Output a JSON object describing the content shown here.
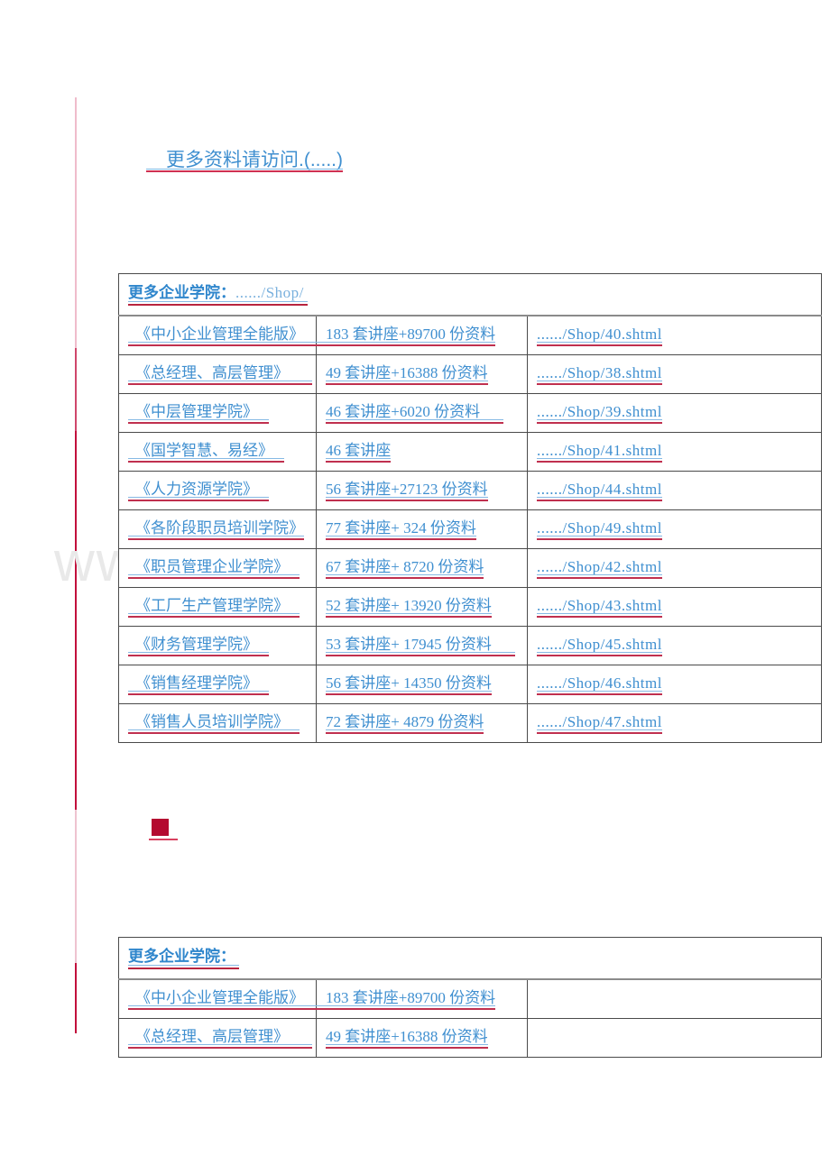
{
  "document": {
    "heading": "更多资料请访问.(.....)",
    "watermark": "www.zixin.com.cn",
    "bullet_marker": "■"
  },
  "colors": {
    "link_blue": "#3f8fd0",
    "heading_blue": "#2f86cc",
    "underline_red": "#c0304f",
    "change_bar_red": "#c2103c",
    "bullet_red": "#b40a30",
    "table_border": "#4a4a4a",
    "watermark_gray": "#e9e9e9"
  },
  "main_table": {
    "header": {
      "title": "更多企业学院：",
      "path": "....../Shop/"
    },
    "rows": [
      {
        "name": "《中小企业管理全能版》",
        "detail": "183 套讲座+89700 份资料",
        "url": "....../Shop/40.shtml"
      },
      {
        "name": "《总经理、高层管理》",
        "detail": "49 套讲座+16388 份资料",
        "url": "....../Shop/38.shtml"
      },
      {
        "name": "《中层管理学院》",
        "detail": "46 套讲座+6020 份资料",
        "url": "....../Shop/39.shtml"
      },
      {
        "name": "《国学智慧、易经》",
        "detail": "46 套讲座",
        "url": "....../Shop/41.shtml"
      },
      {
        "name": "《人力资源学院》",
        "detail": "56 套讲座+27123 份资料",
        "url": "....../Shop/44.shtml"
      },
      {
        "name": "《各阶段职员培训学院》",
        "detail": "77 套讲座+ 324 份资料",
        "url": "....../Shop/49.shtml"
      },
      {
        "name": "《职员管理企业学院》",
        "detail": "67 套讲座+ 8720 份资料",
        "url": "....../Shop/42.shtml"
      },
      {
        "name": "《工厂生产管理学院》",
        "detail": "52 套讲座+ 13920 份资料",
        "url": "....../Shop/43.shtml"
      },
      {
        "name": "《财务管理学院》",
        "detail": "53 套讲座+ 17945 份资料",
        "url": "....../Shop/45.shtml"
      },
      {
        "name": "《销售经理学院》",
        "detail": "56 套讲座+ 14350 份资料",
        "url": "....../Shop/46.shtml"
      },
      {
        "name": "《销售人员培训学院》",
        "detail": "72 套讲座+ 4879 份资料",
        "url": "....../Shop/47.shtml"
      }
    ]
  },
  "sub_table": {
    "header": {
      "title": "更多企业学院：",
      "path": ""
    },
    "rows": [
      {
        "name": "《中小企业管理全能版》",
        "detail": "183 套讲座+89700 份资料",
        "url": ""
      },
      {
        "name": "《总经理、高层管理》",
        "detail": "49 套讲座+16388 份资料",
        "url": ""
      }
    ]
  }
}
